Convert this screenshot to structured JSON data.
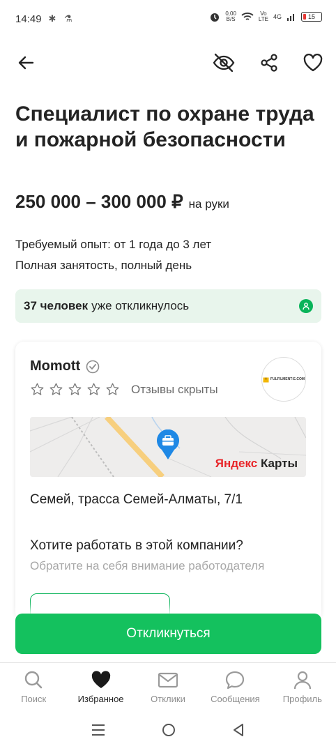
{
  "status": {
    "time": "14:49",
    "left_icons": "✱ ⚗",
    "net_speed_value": "0,00",
    "net_speed_unit": "B/S",
    "volte_top": "Vo",
    "volte_bottom": "LTE",
    "network": "4G",
    "battery": "15"
  },
  "vacancy": {
    "title": "Специалист по охране труда и пожарной безопасности",
    "salary": "250 000 – 300 000 ₽",
    "salary_suffix": "на руки",
    "experience": "Требуемый опыт: от 1 года до 3 лет",
    "employment": "Полная занятость, полный день"
  },
  "responded": {
    "count": "37 человек",
    "text": "уже откликнулось"
  },
  "company": {
    "name": "Momott",
    "reviews": "Отзывы скрыты",
    "logo_text": "FULFILMENT-E.COM",
    "map_brand_y": "Яндекс",
    "map_brand_rest": " Карты",
    "address": "Семей, трасса Семей-Алматы, 7/1",
    "work_question": "Хотите работать в этой компании?",
    "work_hint": "Обратите на себя внимание работодателя"
  },
  "actions": {
    "respond": "Откликнуться"
  },
  "tabs": [
    {
      "label": "Поиск",
      "icon": "search-icon"
    },
    {
      "label": "Избранное",
      "icon": "heart-icon"
    },
    {
      "label": "Отклики",
      "icon": "mail-icon"
    },
    {
      "label": "Сообщения",
      "icon": "chat-icon"
    },
    {
      "label": "Профиль",
      "icon": "profile-icon"
    }
  ],
  "colors": {
    "accent": "#14c15e",
    "accent_dark": "#0ab45a",
    "responded_bg": "#e8f5ec",
    "map_pin": "#1e88e5",
    "yandex_red": "#e8262a"
  }
}
